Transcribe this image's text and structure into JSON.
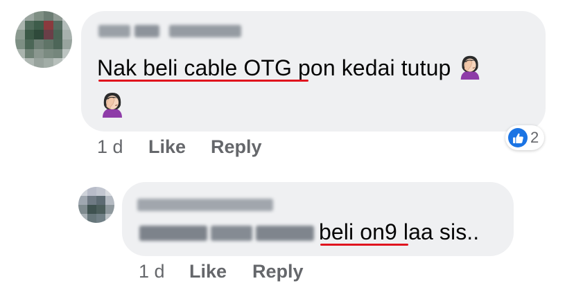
{
  "comment": {
    "text_part1": "Nak beli cable OTG",
    "text_part2": " pon kedai tutup ",
    "emoji_name": "woman-facepalming-emoji",
    "time": "1 d",
    "like_label": "Like",
    "reply_label": "Reply",
    "reaction_count": "2",
    "reaction_type": "like-icon"
  },
  "reply": {
    "text": "beli on9",
    "text_tail": " laa sis..",
    "time": "1 d",
    "like_label": "Like",
    "reply_label": "Reply"
  },
  "colors": {
    "bubble": "#eff0f2",
    "meta_text": "#65676b",
    "underline": "#e0141e",
    "like_blue": "#1b74e4"
  }
}
